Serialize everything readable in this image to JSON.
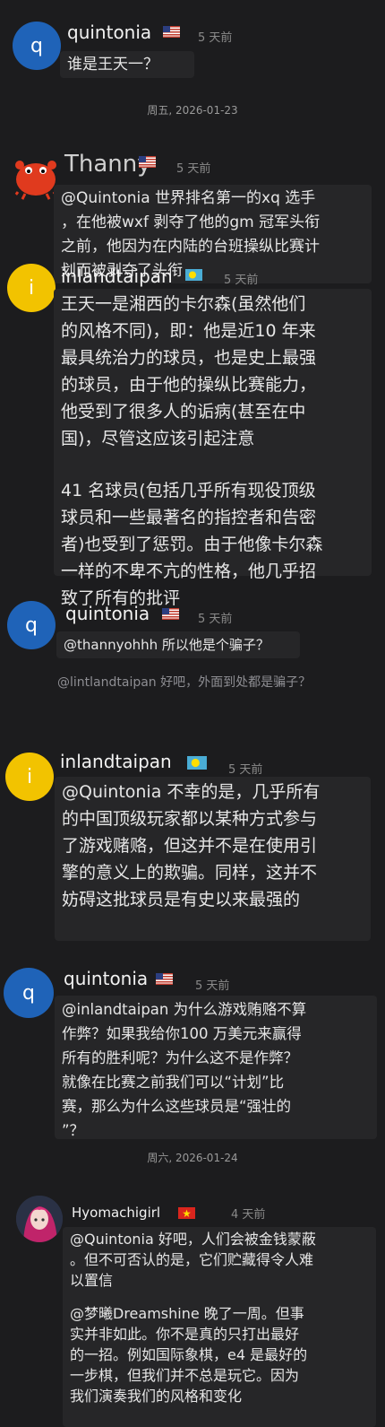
{
  "messages": [
    {
      "user": "quintonia",
      "time": "5 天前",
      "text": "谁是王天一？"
    },
    {
      "user": "Thanny",
      "time": "5 天前",
      "lines": [
        "@Quintonia 世界排名第一的xq 选手",
        "，在他被wxf 剥夺了他的gm 冠军头衔",
        "之前，他因为在内陆的台班操纵比赛计",
        "划而被剥夺了头衔"
      ]
    },
    {
      "user": "inlandtaipan",
      "time": "5 天前",
      "lines": [
        "王天一是湘西的卡尔森(虽然他们",
        "的风格不同)，即：他是近10 年来",
        "最具统治力的球员，也是史上最强",
        "的球员，由于他的操纵比赛能力，",
        "他受到了很多人的诟病(甚至在中",
        "国)，尽管这应该引起注意"
      ],
      "lines2": [
        "41 名球员(包括几乎所有现役顶级",
        "球员和一些最著名的指控者和告密",
        "者)也受到了惩罚。由于他像卡尔森",
        "一样的不卑不亢的性格，他几乎招",
        "致了所有的批评"
      ]
    },
    {
      "user": "quintonia",
      "time": "5 天前",
      "text": "@thannyohhh 所以他是个骗子？",
      "quote": "@lintlandtaipan 好吧，外面到处都是骗子？"
    },
    {
      "user": "inlandtaipan",
      "time": "5 天前",
      "lines": [
        "@Quintonia 不幸的是，几乎所有",
        "的中国顶级玩家都以某种方式参与",
        "了游戏赌赂，但这并不是在使用引",
        "擎的意义上的欺骗。同样，这并不",
        "妨碍这批球员是有史以来最强的"
      ]
    },
    {
      "user": "quintonia",
      "time": "5 天前",
      "lines": [
        "@inlandtaipan 为什么游戏贿赂不算",
        "作弊？如果我给你100 万美元来赢得",
        "所有的胜利呢？为什么这不是作弊？",
        "就像在比赛之前我们可以“计划”比",
        "赛，那么为什么这些球员是“强壮的",
        "”？"
      ]
    },
    {
      "user": "Hyomachigirl",
      "time": "4 天前",
      "lines": [
        "@Quintonia 好吧，人们会被金钱蒙蔽",
        "。但不可否认的是，它们贮藏得令人难",
        "以置信"
      ],
      "lines2": [
        "@梦曦Dreamshine 晚了一周。但事",
        "实并非如此。你不是真的只打出最好",
        "的一招。例如国际象棋，e4 是最好的",
        "一步棋，但我们并不总是玩它。因为",
        "我们演奏我们的风格和变化"
      ]
    }
  ],
  "dates": [
    "周五, 2026-01-23",
    "周六, 2026-01-24"
  ],
  "avatars": {
    "q": "q",
    "i": "i"
  },
  "colors": {
    "bg": "#1c1c1e",
    "bubble": "#262628",
    "q_avatar": "#1f63b8",
    "i_avatar": "#f2c300"
  }
}
